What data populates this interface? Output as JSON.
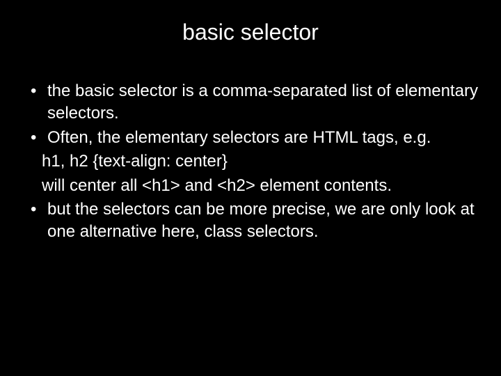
{
  "slide": {
    "title": "basic selector",
    "items": [
      {
        "type": "bullet",
        "text": "the basic selector is a comma-separated list of elementary  selectors."
      },
      {
        "type": "bullet",
        "text": "Often, the elementary selectors are HTML tags, e.g."
      },
      {
        "type": "sub",
        "text": "h1, h2 {text-align: center}"
      },
      {
        "type": "sub",
        "text": "will center all <h1> and <h2> element contents."
      },
      {
        "type": "bullet",
        "text": "but the selectors can be more precise, we are only look at one alternative here, class selectors."
      }
    ]
  }
}
